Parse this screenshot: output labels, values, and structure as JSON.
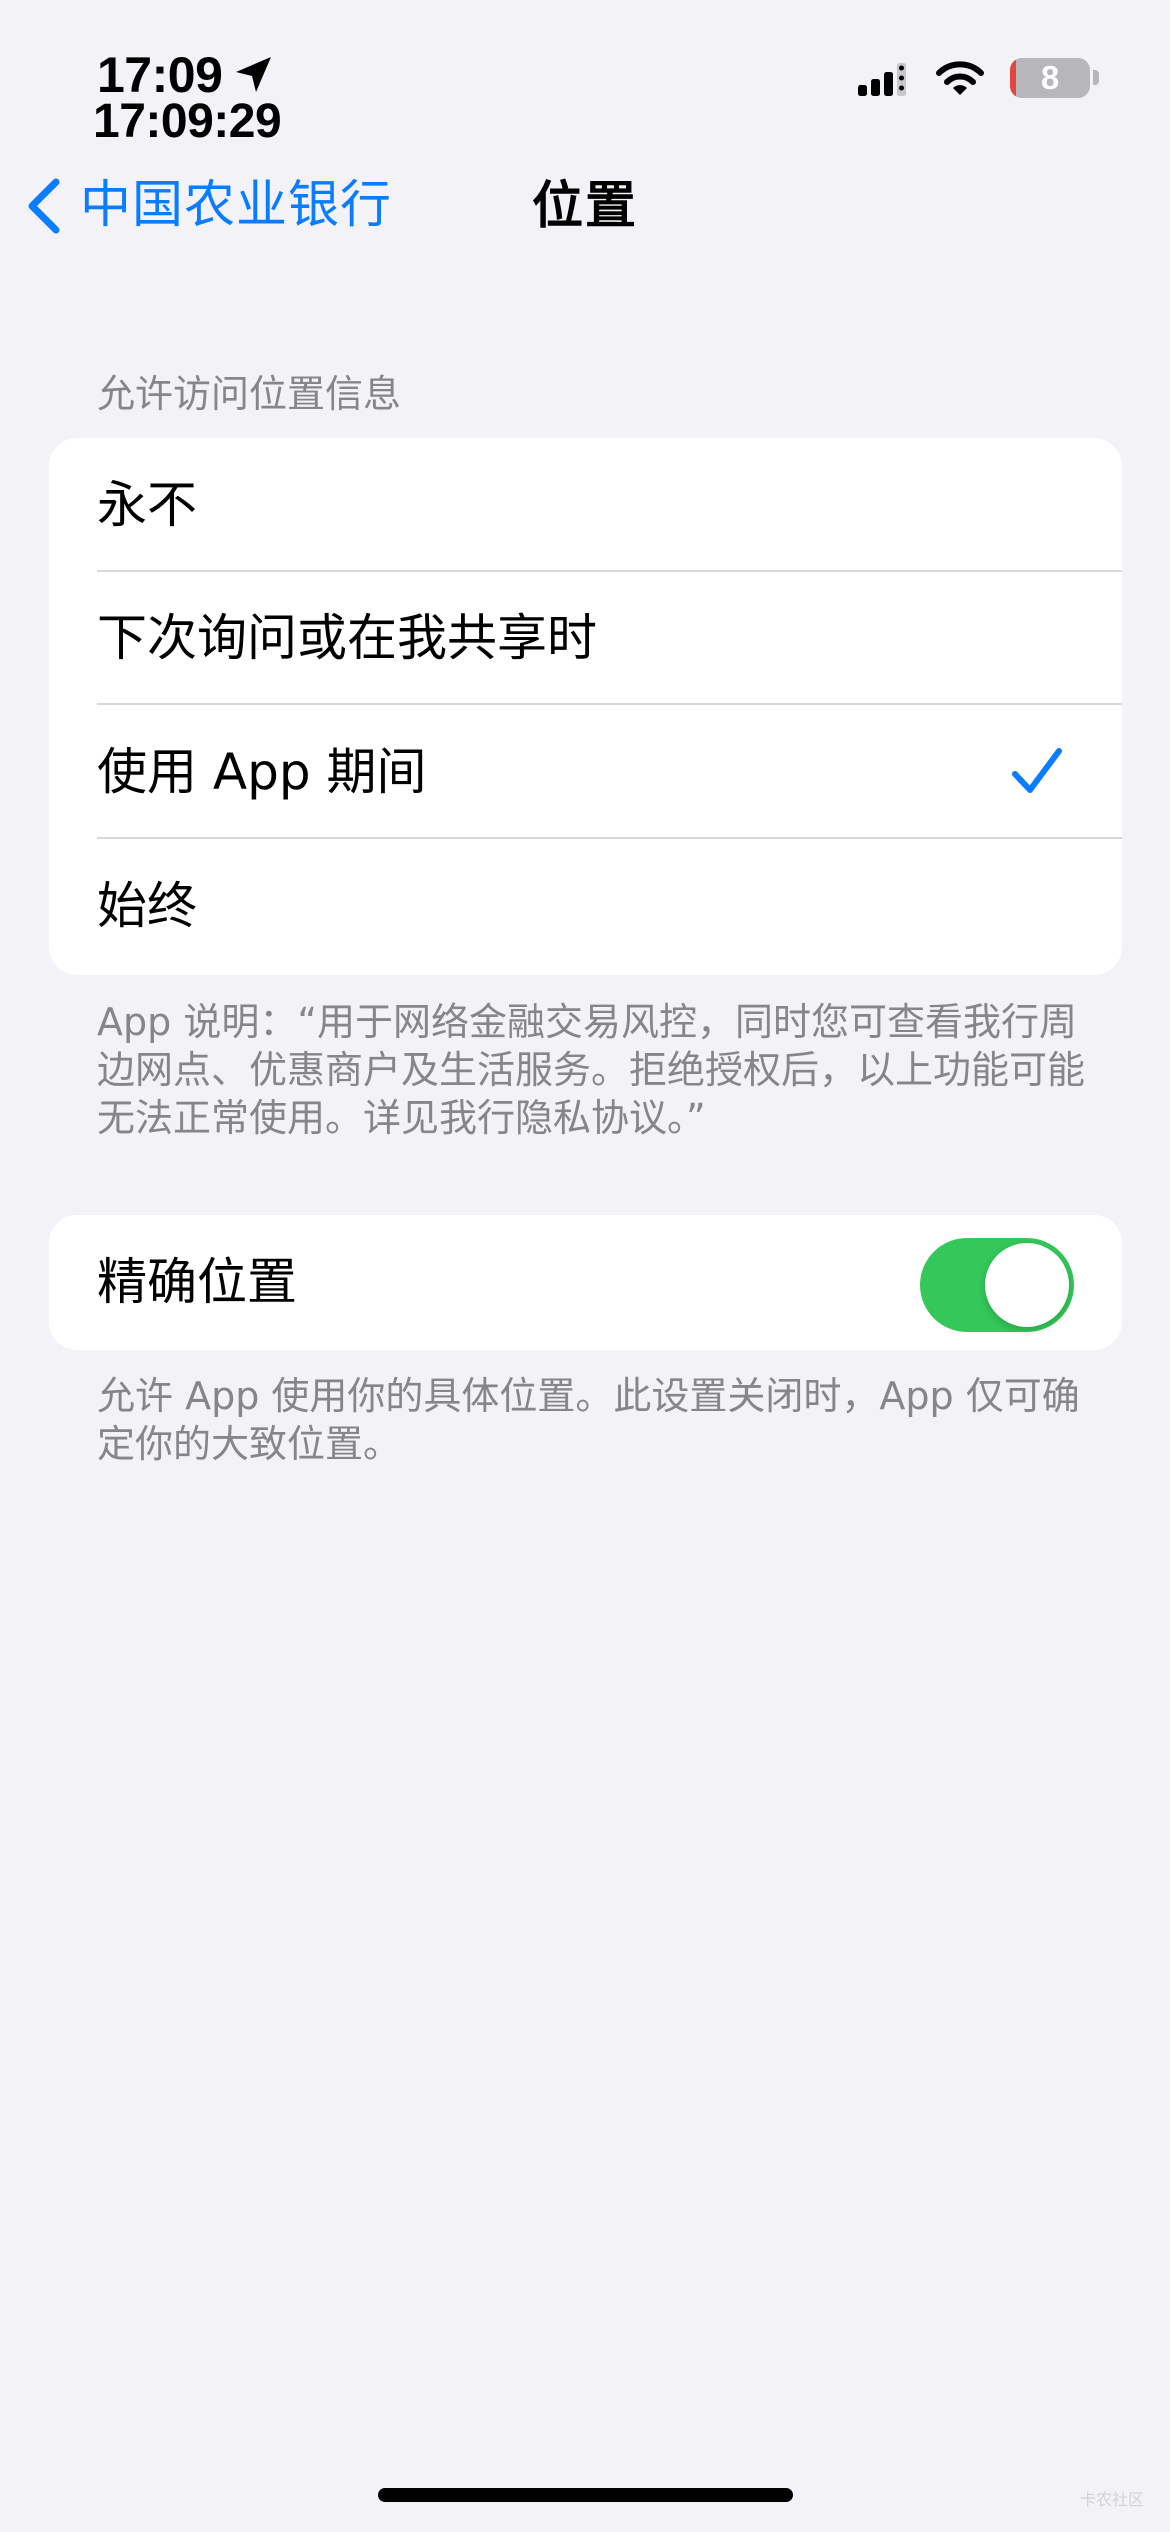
{
  "status_bar": {
    "time": "17:09",
    "time_seconds": "17:09:29",
    "battery_level": "8",
    "battery_color": "#e3463e",
    "icons": [
      "location-arrow-icon",
      "signal-icon",
      "wifi-icon",
      "battery-icon"
    ]
  },
  "navigation": {
    "back_label": "中国农业银行",
    "back_icon": "chevron-left-icon",
    "title": "位置",
    "accent_color": "#0a7cff"
  },
  "location_access": {
    "header": "允许访问位置信息",
    "options": [
      {
        "label": "永不",
        "selected": false
      },
      {
        "label": "下次询问或在我共享时",
        "selected": false
      },
      {
        "label": "使用 App 期间",
        "selected": true
      },
      {
        "label": "始终",
        "selected": false
      }
    ],
    "selected_icon": "checkmark-icon",
    "footer": "App 说明：“用于网络金融交易风控，同时您可查看我行周边网点、优惠商户及生活服务。拒绝授权后，以上功能可能无法正常使用。详见我行隐私协议。”"
  },
  "precise_location": {
    "label": "精确位置",
    "enabled": true,
    "toggle_color": "#34c759",
    "footer": "允许 App 使用你的具体位置。此设置关闭时，App 仅可确定你的大致位置。"
  },
  "watermark": "卡农社区"
}
